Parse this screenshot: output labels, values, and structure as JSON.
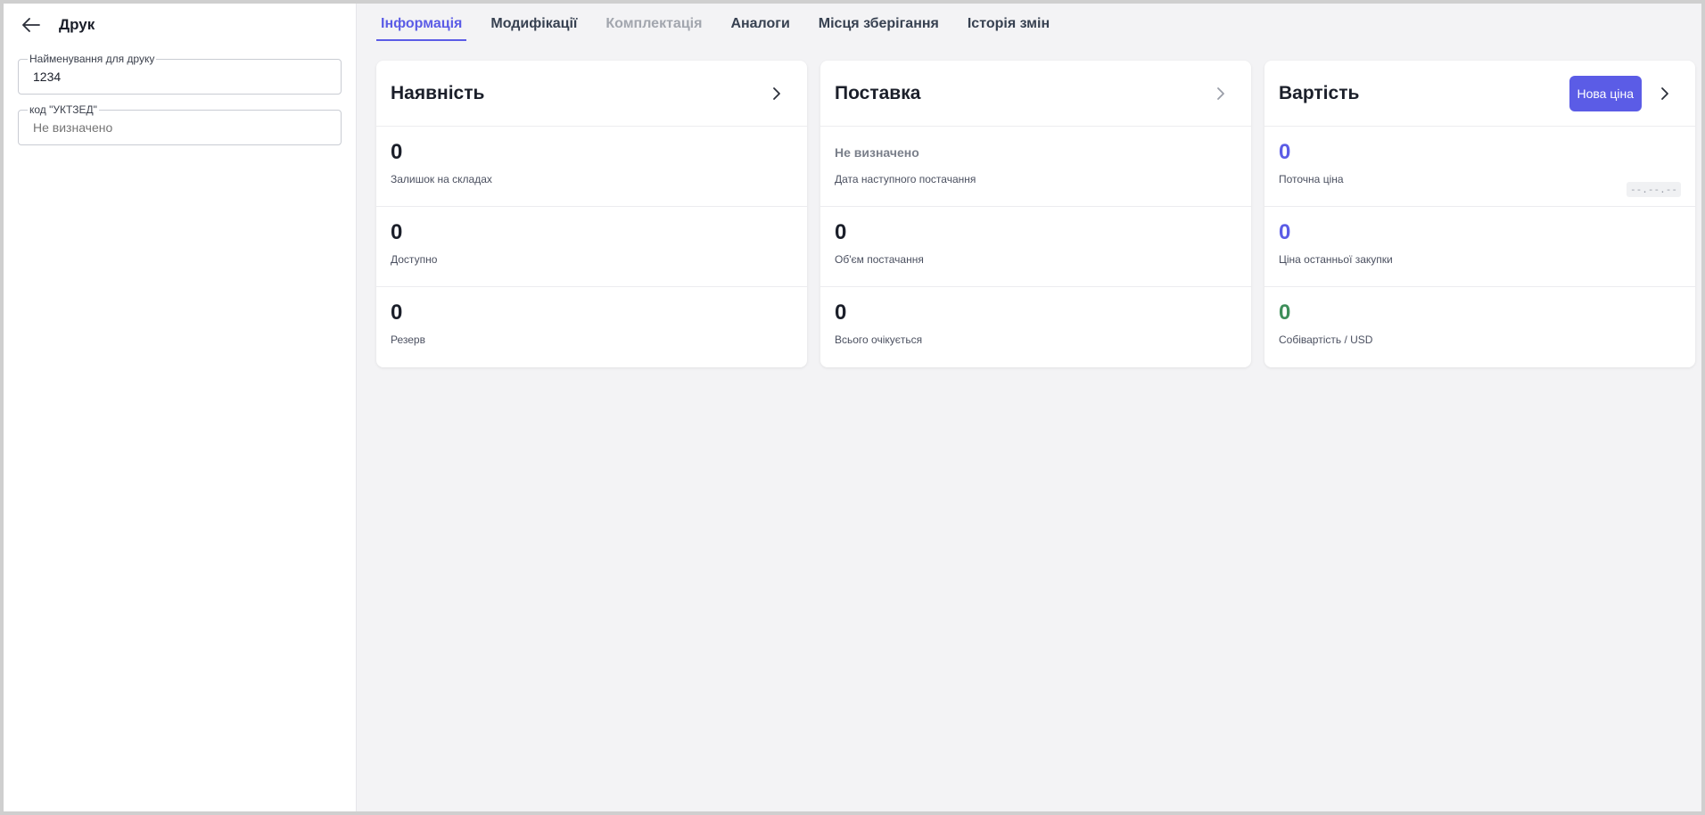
{
  "sidebar": {
    "title": "Друк",
    "fields": [
      {
        "label": "Найменування для друку",
        "value": "1234",
        "placeholder": ""
      },
      {
        "label": "код \"УКТЗЕД\"",
        "value": "",
        "placeholder": "Не визначено"
      }
    ]
  },
  "tabs": [
    {
      "label": "Інформація",
      "state": "active"
    },
    {
      "label": "Модифікації",
      "state": "normal"
    },
    {
      "label": "Комплектація",
      "state": "disabled"
    },
    {
      "label": "Аналоги",
      "state": "normal"
    },
    {
      "label": "Місця зберігання",
      "state": "normal"
    },
    {
      "label": "Історія змін",
      "state": "normal"
    }
  ],
  "cards": {
    "availability": {
      "title": "Наявність",
      "metrics": [
        {
          "value": "0",
          "label": "Залишок на складах"
        },
        {
          "value": "0",
          "label": "Доступно"
        },
        {
          "value": "0",
          "label": "Резерв"
        }
      ]
    },
    "supply": {
      "title": "Поставка",
      "metrics": [
        {
          "value": "Не визначено",
          "label": "Дата наступного постачання"
        },
        {
          "value": "0",
          "label": "Об'єм постачання"
        },
        {
          "value": "0",
          "label": "Всього очікується"
        }
      ]
    },
    "cost": {
      "title": "Вартість",
      "button": "Нова ціна",
      "date_chip": "--.--.--",
      "metrics": [
        {
          "value": "0",
          "label": "Поточна ціна"
        },
        {
          "value": "0",
          "label": "Ціна останньої закупки"
        },
        {
          "value": "0",
          "label": "Собівартість / USD"
        }
      ]
    }
  },
  "colors": {
    "accent": "#5b5ce6",
    "green": "#3e8e5a",
    "background": "#f3f3f5"
  },
  "icons": {
    "back": "arrow-left-icon",
    "chevron": "chevron-right-icon"
  }
}
